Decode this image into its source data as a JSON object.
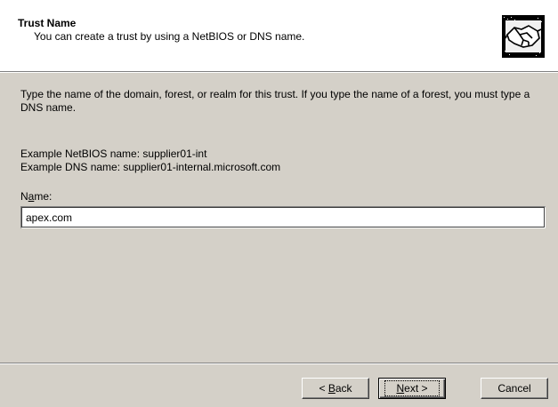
{
  "header": {
    "title": "Trust Name",
    "subtitle": "You can create a trust by using a NetBIOS or DNS name."
  },
  "body": {
    "description": "Type the name of the domain, forest, or realm for this trust. If you type the name of a forest, you must type a DNS name.",
    "example_netbios": "Example NetBIOS name: supplier01-int",
    "example_dns": "Example DNS name: supplier01-internal.microsoft.com",
    "name_label_pre": "N",
    "name_label_access": "a",
    "name_label_post": "me:",
    "name_value": "apex.com"
  },
  "buttons": {
    "back_prefix": "< ",
    "back_access": "B",
    "back_rest": "ack",
    "next_access": "N",
    "next_rest": "ext >",
    "cancel": "Cancel"
  },
  "icons": {
    "header_icon": "handshake-icon"
  }
}
